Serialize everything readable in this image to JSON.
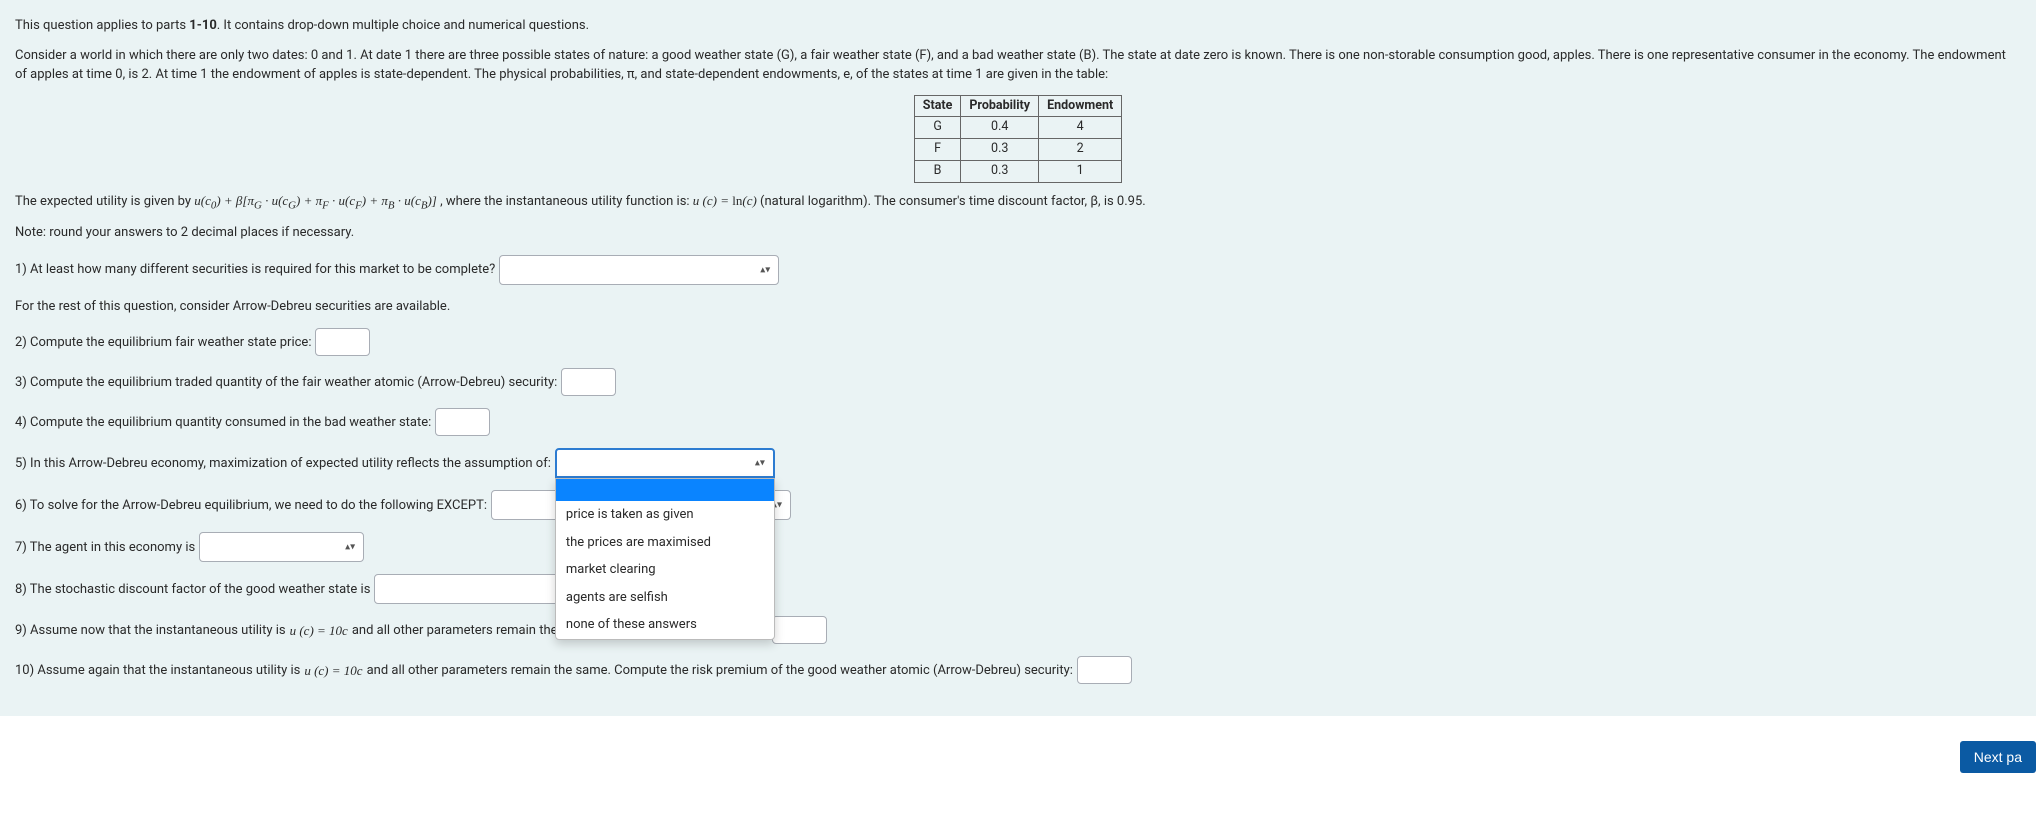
{
  "intro": {
    "applies": "This question applies to parts 1-10. It contains drop-down multiple choice and numerical questions.",
    "world": "Consider a world in which there are only two dates: 0 and 1. At date 1 there are three possible states of nature: a good weather state (G), a fair weather state (F), and a bad weather state (B). The state at date zero is known. There is one non-storable consumption good, apples. There is one representative consumer in the economy. The endowment of apples at time 0, is 2. At time 1 the endowment of apples is state-dependent. The physical probabilities, π, and state-dependent endowments, e, of the states at time 1 are given in the table:"
  },
  "table": {
    "headers": {
      "state": "State",
      "prob": "Probability",
      "endow": "Endowment"
    },
    "rows": [
      {
        "state": "G",
        "prob": "0.4",
        "endow": "4"
      },
      {
        "state": "F",
        "prob": "0.3",
        "endow": "2"
      },
      {
        "state": "B",
        "prob": "0.3",
        "endow": "1"
      }
    ]
  },
  "utility": {
    "leadin": "The expected utility is given by ",
    "formula_html": "u(c<sub>0</sub>) + β[π<sub>G</sub> · u(c<sub>G</sub>) + π<sub>F</sub> · u(c<sub>F</sub>) + π<sub>B</sub> · u(c<sub>B</sub>)]",
    "mid": ", where the instantaneous utility function is: ",
    "uc_html": "u (c) = <span class=\"rm\">ln</span>(c)",
    "trail": " (natural logarithm). The consumer's time discount factor, β, is 0.95."
  },
  "note": "Note: round your answers to 2 decimal places if necessary.",
  "q1": {
    "label": "1) At least how many different securities is required for this market to be complete?"
  },
  "rest_note": "For the rest of this question, consider Arrow-Debreu securities are available.",
  "q2": {
    "label": "2) Compute the equilibrium fair weather state price:"
  },
  "q3": {
    "label": "3) Compute the equilibrium traded quantity of the fair weather atomic (Arrow-Debreu) security:"
  },
  "q4": {
    "label": "4) Compute the equilibrium quantity consumed in the bad weather state:"
  },
  "q5": {
    "label": "5) In this Arrow-Debrew economy, maximization of expected utility reflects the assumption of:",
    "label_fixed": "5) In this Arrow-Debreu economy, maximization of expected utility reflects the assumption of:",
    "options": [
      "",
      "price is taken as given",
      "the prices are maximised",
      "market clearing",
      "agents are selfish",
      "none of these answers"
    ]
  },
  "q6": {
    "label": "6) To solve for the Arrow-Debreu equilibrium, we need to do the following EXCEPT:"
  },
  "q7": {
    "label": "7) The agent in this economy is"
  },
  "q8": {
    "label": "8) The stochastic discount factor of the good weather state is"
  },
  "q9": {
    "pre": "9) Assume now that the instantaneous utility is ",
    "uc_html": "u (c) = 10c",
    "post": " and all other parameters remain the same. Compute the discount factor:"
  },
  "q10": {
    "pre": "10) Assume again that the instantaneous utility is ",
    "uc_html": "u (c) = 10c",
    "post": " and all other parameters remain the same. Compute the risk premium of the good weather atomic (Arrow-Debreu) security:"
  },
  "footer": {
    "next": "Next pa"
  }
}
